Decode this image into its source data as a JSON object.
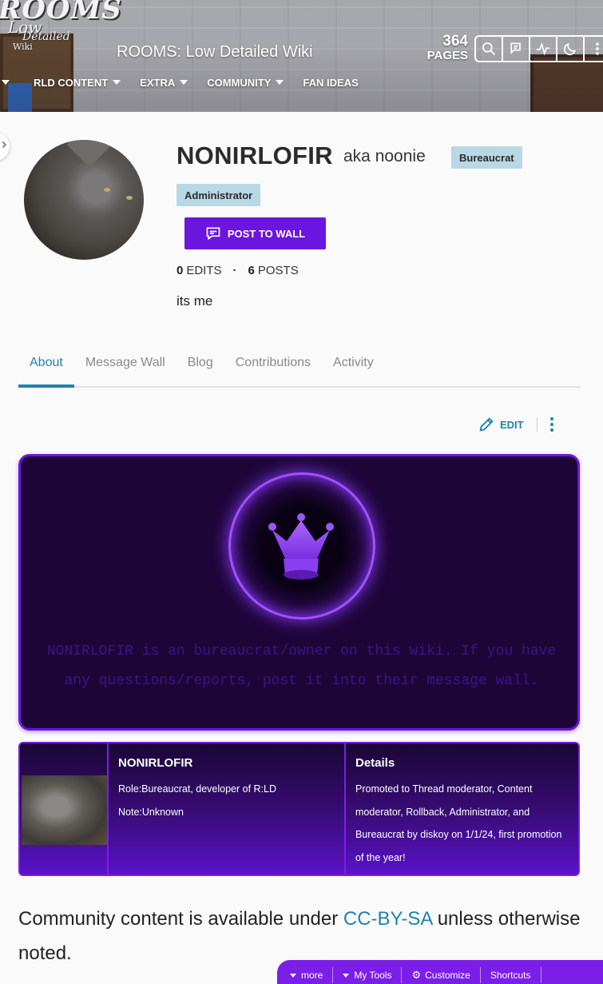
{
  "header": {
    "logo_lines": [
      "ROOMS",
      "Low",
      "Detailed",
      "Wiki"
    ],
    "wiki_title": "ROOMS: Low Detailed Wiki",
    "page_count": "364",
    "pages_label": "PAGES",
    "tools": [
      "search-icon",
      "discussions-icon",
      "activity-icon",
      "dark-mode-icon",
      "more-icon"
    ]
  },
  "nav": {
    "items": [
      {
        "label": "RLD CONTENT",
        "dropdown": true
      },
      {
        "label": "EXTRA",
        "dropdown": true
      },
      {
        "label": "COMMUNITY",
        "dropdown": true
      },
      {
        "label": "FAN IDEAS",
        "dropdown": false
      }
    ]
  },
  "profile": {
    "username": "NONIRLOFIR",
    "aka": "aka noonie",
    "badges": [
      "Bureaucrat",
      "Administrator"
    ],
    "post_button": "POST TO WALL",
    "edits_count": "0",
    "edits_label": "EDITS",
    "posts_count": "6",
    "posts_label": "POSTS",
    "bio": "its me"
  },
  "tabs": [
    "About",
    "Message Wall",
    "Blog",
    "Contributions",
    "Activity"
  ],
  "active_tab": "About",
  "edit_label": "EDIT",
  "card": {
    "text": "NONIRLOFIR is an bureaucrat/owner on this wiki. If you have any questions/reports, post it into their message wall.",
    "colors": {
      "background": "#1e0538",
      "border": "#6b16e0",
      "text": "#3b1487"
    }
  },
  "infobox": {
    "name": "NONIRLOFIR",
    "role": "Role:Bureaucrat, developer of R:LD",
    "note": "Note:Unknown",
    "details_heading": "Details",
    "details": "Promoted to Thread moderator, Content moderator, Rollback, Administrator, and Bureaucrat by diskoy on 1/1/24, first promotion of the year!"
  },
  "footer": {
    "prefix": "Community content is available under ",
    "license": "CC-BY-SA",
    "suffix": " unless otherwise noted."
  },
  "toolbar": {
    "items": [
      "more",
      "My Tools",
      "Customize",
      "Shortcuts"
    ]
  },
  "colors": {
    "accent": "#1f82b0",
    "purple": "#6b16e0",
    "badge": "#b8d8e6"
  }
}
